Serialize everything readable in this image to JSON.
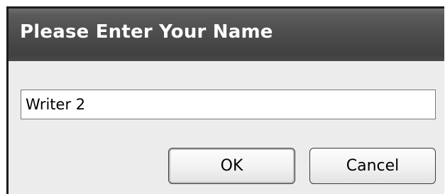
{
  "dialog": {
    "title": "Please Enter Your Name",
    "name_field": {
      "value": "Writer 2"
    },
    "buttons": {
      "ok_label": "OK",
      "cancel_label": "Cancel"
    }
  }
}
